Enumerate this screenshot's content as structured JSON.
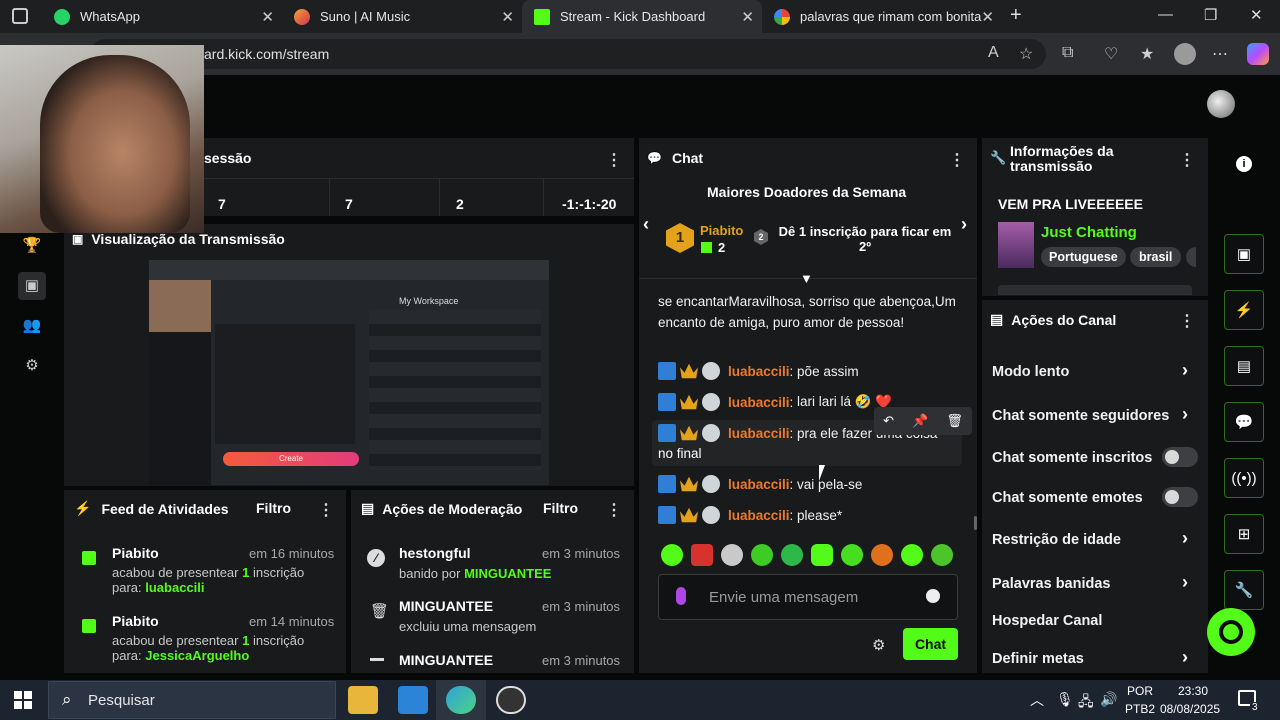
{
  "browser": {
    "tabs": [
      {
        "title": "WhatsApp",
        "icon": "whatsapp-icon",
        "color": "#25d366"
      },
      {
        "title": "Suno | AI Music",
        "icon": "suno-icon",
        "color": "#e8542c"
      },
      {
        "title": "Stream - Kick Dashboard",
        "icon": "kick-icon",
        "color": "#53fc18"
      },
      {
        "title": "palavras que rimam com bonita -",
        "icon": "google-icon",
        "color": "#4285f4"
      }
    ],
    "url": "ard.kick.com/stream"
  },
  "session": {
    "title": "sessão",
    "stats": [
      "7",
      "7",
      "2",
      "-1:-1:-20"
    ]
  },
  "preview": {
    "title": "Visualização da Transmissão",
    "inner_workspace": "My Workspace",
    "inner_create": "Create"
  },
  "chat": {
    "title": "Chat",
    "top_donors_title": "Maiores Doadores da Semana",
    "donor_name": "Piabito",
    "donor_count": "2",
    "donor_rank": "1",
    "next_rank": "2",
    "next_text": "Dê 1 inscrição para ficar em 2º",
    "prev_message": "se encantarMaravilhosa, sorriso que abençoa,Um encanto de amiga, puro amor de pessoa!",
    "messages": [
      {
        "user": "luabaccili",
        "text": "põe assim"
      },
      {
        "user": "luabaccili",
        "text": "lari lari lá 🤣 ❤️"
      },
      {
        "user": "luabaccili",
        "text": "pra ele fazer uma coisa",
        "cont": "no final"
      },
      {
        "user": "luabaccili",
        "text": "vai pela-se"
      },
      {
        "user": "luabaccili",
        "text": "please*"
      }
    ],
    "input_placeholder": "Envie uma mensagem",
    "send_label": "Chat"
  },
  "stream_info": {
    "title": "Informações da transmissão",
    "stream_title": "VEM PRA LIVEEEEEE",
    "category": "Just Chatting",
    "tags": [
      "Portuguese",
      "brasil"
    ]
  },
  "channel_actions": {
    "title": "Ações do Canal",
    "items": [
      {
        "label": "Modo lento",
        "type": "chevron"
      },
      {
        "label": "Chat somente seguidores",
        "type": "chevron"
      },
      {
        "label": "Chat somente inscritos",
        "type": "toggle",
        "on": false
      },
      {
        "label": "Chat somente emotes",
        "type": "toggle",
        "on": false
      },
      {
        "label": "Restrição de idade",
        "type": "chevron"
      },
      {
        "label": "Palavras banidas",
        "type": "chevron"
      },
      {
        "label": "Hospedar Canal",
        "type": "none"
      },
      {
        "label": "Definir metas",
        "type": "chevron"
      }
    ]
  },
  "activity_feed": {
    "title": "Feed de Atividades",
    "filter": "Filtro",
    "items": [
      {
        "user": "Piabito",
        "time": "em 16 minutos",
        "text_a": "acabou de presentear ",
        "num": "1",
        "text_b": " inscrição",
        "to_label": "para: ",
        "to": "luabaccili"
      },
      {
        "user": "Piabito",
        "time": "em 14 minutos",
        "text_a": "acabou de presentear ",
        "num": "1",
        "text_b": " inscrição",
        "to_label": "para: ",
        "to": "JessicaArguelho"
      }
    ]
  },
  "moderation": {
    "title": "Ações de Moderação",
    "filter": "Filtro",
    "items": [
      {
        "user": "hestongful",
        "time": "em 3 minutos",
        "text": "banido por ",
        "by": "MINGUANTEE",
        "icon": "ban-icon"
      },
      {
        "user": "MINGUANTEE",
        "time": "em 3 minutos",
        "text": "excluiu uma mensagem",
        "by": "",
        "icon": "trash-icon"
      },
      {
        "user": "MINGUANTEE",
        "time": "em 3 minutos",
        "text": "",
        "by": "",
        "icon": "minus-icon"
      }
    ]
  },
  "taskbar": {
    "search_placeholder": "Pesquisar",
    "lang": "POR",
    "layout": "PTB2",
    "time": "23:30",
    "date": "08/08/2025",
    "notif_count": "3"
  },
  "colors": {
    "accent": "#53fc18",
    "panel": "#181a1b",
    "bg": "#070808"
  }
}
